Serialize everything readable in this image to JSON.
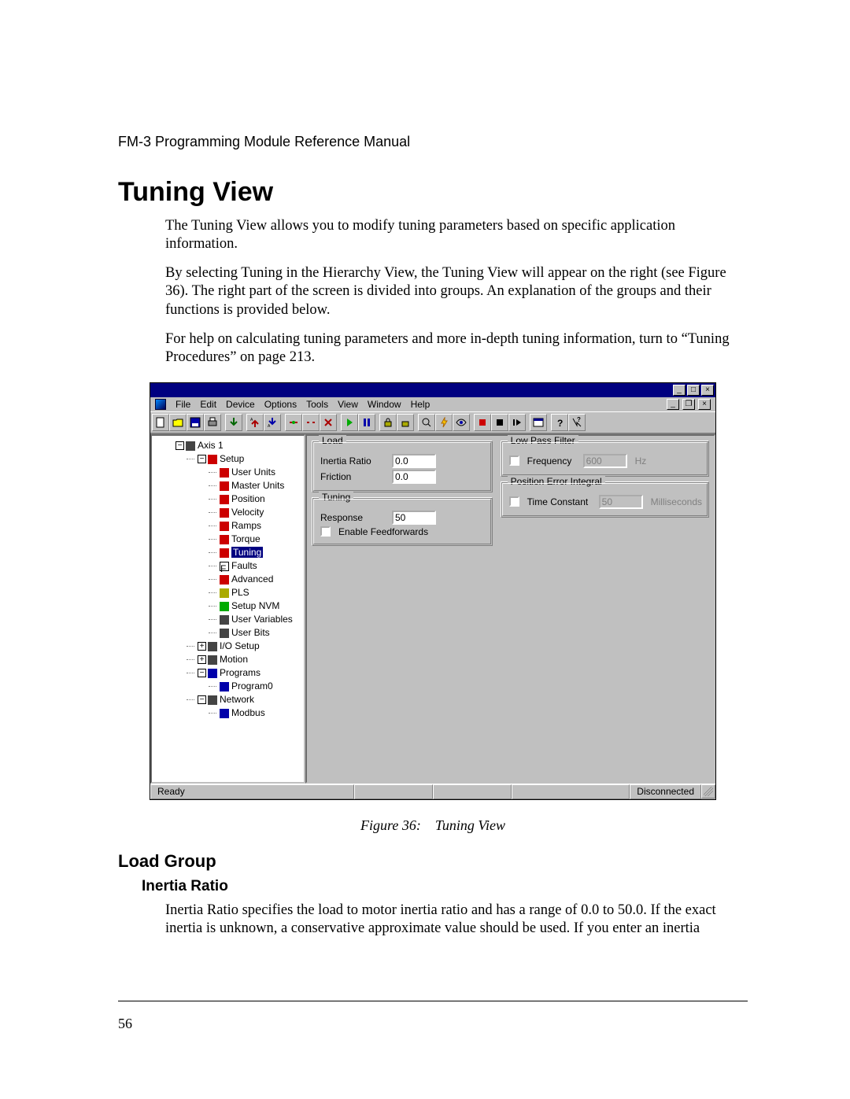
{
  "page": {
    "header": "FM-3 Programming Module Reference Manual",
    "title": "Tuning View",
    "para1": "The Tuning View allows you to modify tuning parameters based on specific application information.",
    "para2": "By selecting Tuning in the Hierarchy View, the Tuning View will appear on the right (see Figure 36). The right part of the screen is divided into groups. An explanation of the groups and their functions is provided below.",
    "para3": "For help on calculating tuning parameters and more in-depth tuning information, turn to “Tuning Procedures” on page 213.",
    "figure_caption": "Figure 36: Tuning View",
    "subsection": "Load Group",
    "subsub": "Inertia Ratio",
    "para4": "Inertia Ratio specifies the load to motor inertia ratio and has a range of 0.0 to 50.0. If the exact inertia is unknown, a conservative approximate value should be used. If you enter an inertia",
    "number": "56"
  },
  "screenshot": {
    "menus": [
      "File",
      "Edit",
      "Device",
      "Options",
      "Tools",
      "View",
      "Window",
      "Help"
    ],
    "tree": {
      "root": "Axis 1",
      "setup": "Setup",
      "items": [
        "User Units",
        "Master Units",
        "Position",
        "Velocity",
        "Ramps",
        "Torque"
      ],
      "selected": "Tuning",
      "after": [
        "Faults",
        "Advanced",
        "PLS",
        "Setup NVM",
        "User Variables",
        "User Bits"
      ],
      "io": "I/O Setup",
      "motion": "Motion",
      "programs": "Programs",
      "program0": "Program0",
      "network": "Network",
      "modbus": "Modbus"
    },
    "groups": {
      "load": {
        "legend": "Load",
        "inertia_label": "Inertia Ratio",
        "inertia_value": "0.0",
        "friction_label": "Friction",
        "friction_value": "0.0"
      },
      "tuning": {
        "legend": "Tuning",
        "response_label": "Response",
        "response_value": "50",
        "feedfwd_label": "Enable Feedforwards"
      },
      "lpf": {
        "legend": "Low Pass Filter",
        "freq_label": "Frequency",
        "freq_value": "600",
        "freq_unit": "Hz"
      },
      "pei": {
        "legend": "Position Error Integral",
        "tc_label": "Time Constant",
        "tc_value": "50",
        "tc_unit": "Milliseconds"
      }
    },
    "status": {
      "ready": "Ready",
      "disconnected": "Disconnected"
    }
  }
}
